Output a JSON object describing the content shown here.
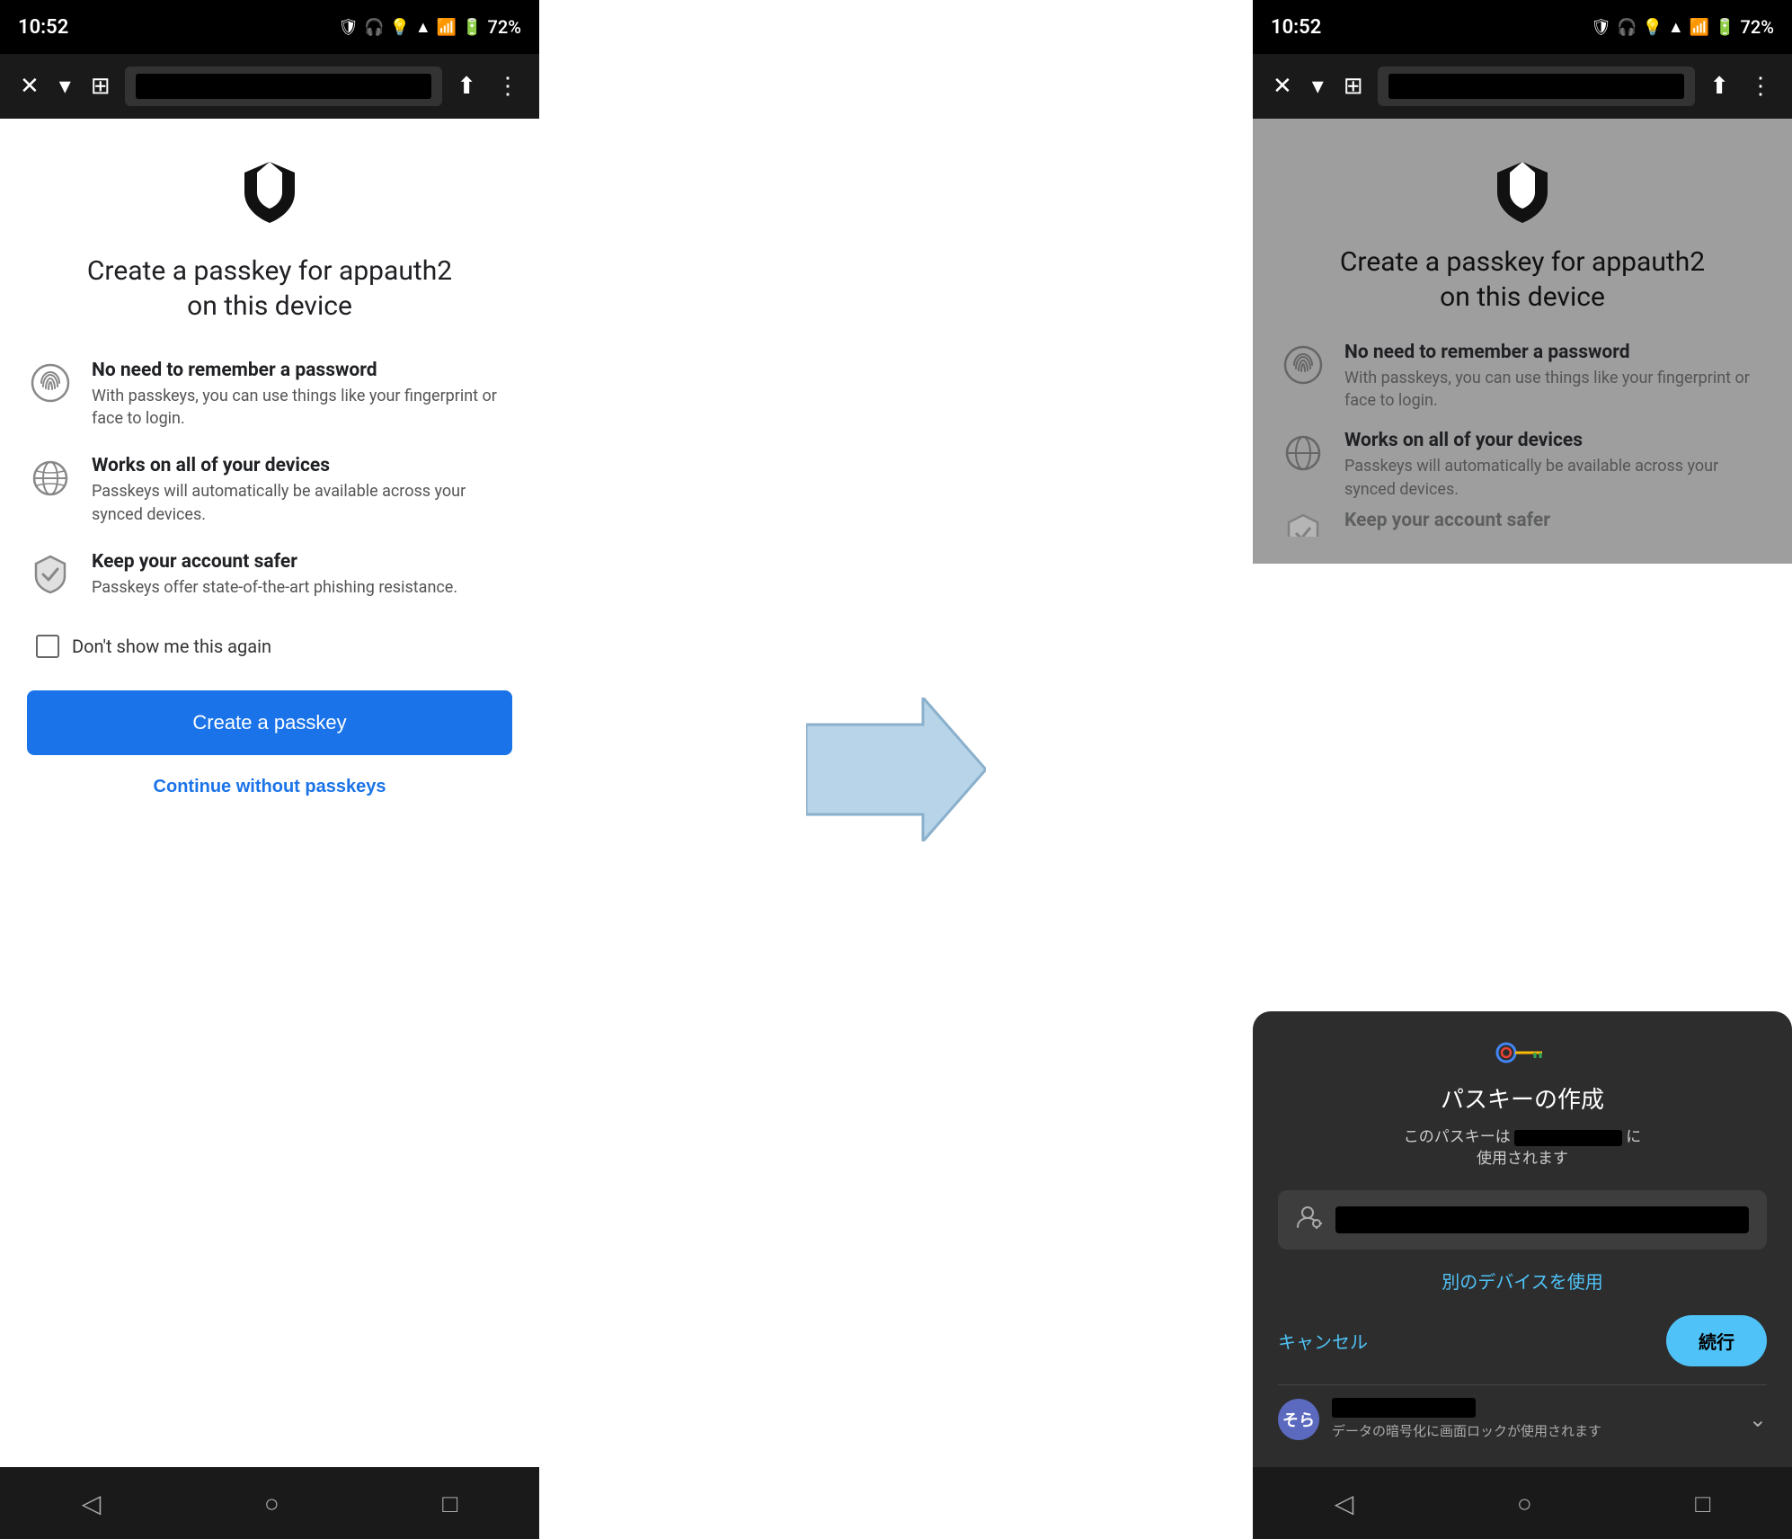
{
  "left_phone": {
    "status_bar": {
      "time": "10:52",
      "battery": "72%"
    },
    "shield_alt": "AppAuth shield logo",
    "main_title": "Create a passkey for appauth2\non this device",
    "features": [
      {
        "icon": "fingerprint",
        "title": "No need to remember a password",
        "desc": "With passkeys, you can use things like your fingerprint or face to login."
      },
      {
        "icon": "globe",
        "title": "Works on all of your devices",
        "desc": "Passkeys will automatically be available across your synced devices."
      },
      {
        "icon": "shield-check",
        "title": "Keep your account safer",
        "desc": "Passkeys offer state-of-the-art phishing resistance."
      }
    ],
    "checkbox_label": "Don't show me this again",
    "create_passkey_btn": "Create a passkey",
    "continue_link": "Continue without passkeys"
  },
  "right_phone": {
    "status_bar": {
      "time": "10:52",
      "battery": "72%"
    },
    "main_title": "Create a passkey for appauth2\non this device",
    "modal": {
      "title": "パスキーの作成",
      "subtitle_prefix": "このパスキーは",
      "subtitle_suffix": "に\n使用されます",
      "other_device": "別のデバイスを使用",
      "cancel_btn": "キャンセル",
      "continue_btn": "続行",
      "account_hint": "データの暗号化に画面ロックが使用されます",
      "avatar_text": "そら"
    }
  },
  "arrow": {
    "alt": "Arrow pointing right"
  }
}
